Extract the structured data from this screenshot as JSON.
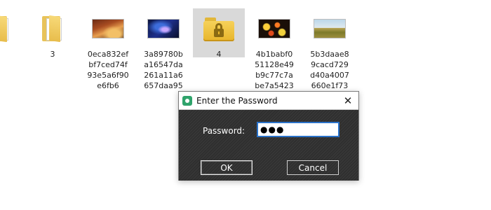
{
  "files": [
    {
      "name": "3",
      "label_lines": [
        "3"
      ],
      "type": "folder"
    },
    {
      "name": "0eca832efbf7ced74f93e5a6f90e6fb6",
      "label_lines": [
        "0eca832ef",
        "bf7ced74f",
        "93e5a6f90",
        "e6fb6"
      ],
      "type": "image",
      "icon": "canyon-image"
    },
    {
      "name": "3a89780ba16547da261a11a6657daa95",
      "label_lines": [
        "3a89780b",
        "a16547da",
        "261a11a6",
        "657daa95"
      ],
      "type": "image",
      "icon": "space-image"
    },
    {
      "name": "4",
      "label_lines": [
        "4"
      ],
      "type": "locked-folder",
      "selected": true
    },
    {
      "name": "4b1babf051128e49b9c77c7abe7a5423",
      "label_lines": [
        "4b1babf0",
        "51128e49",
        "b9c77c7a",
        "be7a5423"
      ],
      "type": "image",
      "icon": "bokeh-image"
    },
    {
      "name": "5b3daae89cacd729d40a4007660e1f73",
      "label_lines": [
        "5b3daae8",
        "9cacd729",
        "d40a4007",
        "660e1f73"
      ],
      "type": "image",
      "icon": "field-image"
    }
  ],
  "dialog": {
    "title": "Enter the Password",
    "close_glyph": "✕",
    "password_label": "Password:",
    "password_value": "●●●",
    "ok_label": "OK",
    "cancel_label": "Cancel"
  },
  "colors": {
    "input_focus_border": "#2a72c9",
    "dialog_body": "#333333",
    "folder_yellow": "#e7b52b"
  }
}
